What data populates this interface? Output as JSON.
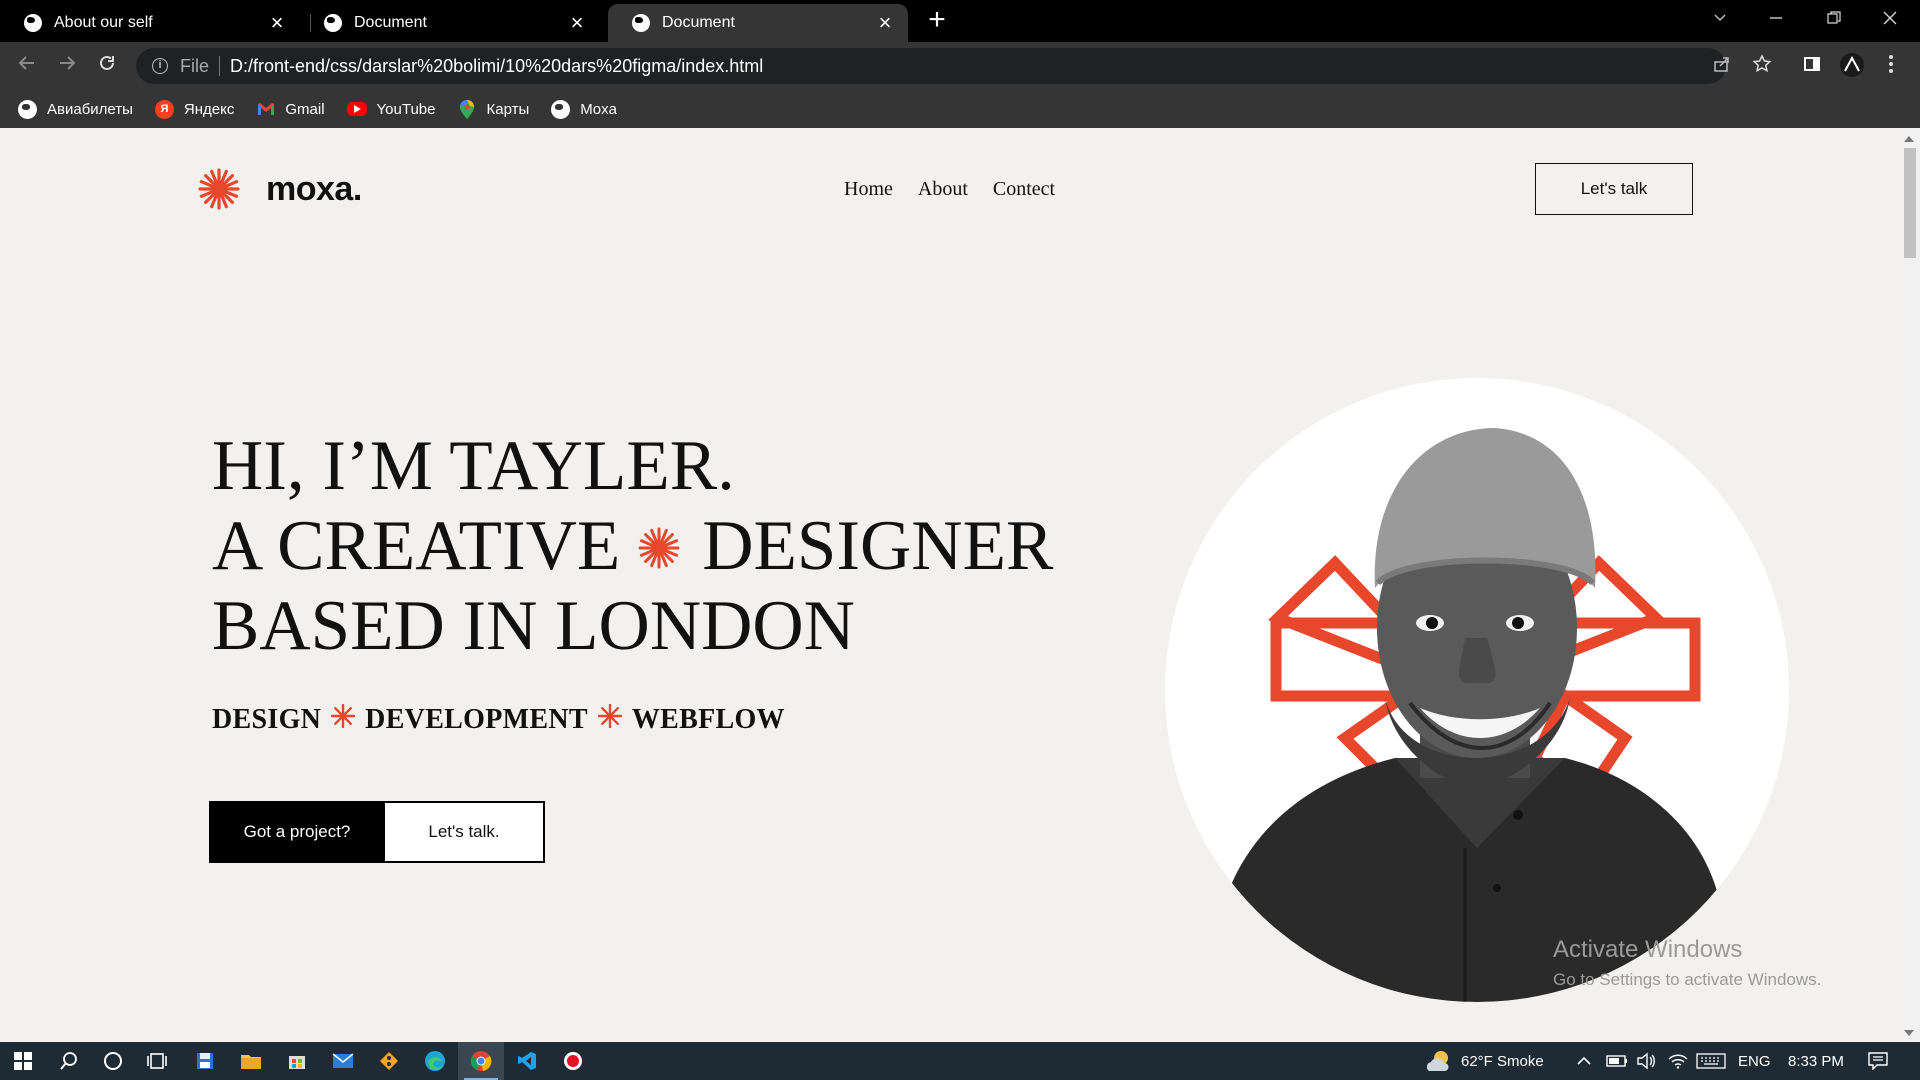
{
  "browser": {
    "tabs": [
      {
        "title": "About our self",
        "active": false
      },
      {
        "title": "Document",
        "active": false
      },
      {
        "title": "Document",
        "active": true
      }
    ],
    "address": {
      "scheme": "File",
      "url": "D:/front-end/css/darslar%20bolimi/10%20dars%20figma/index.html"
    },
    "bookmarks": [
      {
        "label": "Авиабилеты",
        "icon": "globe-icon"
      },
      {
        "label": "Яндекс",
        "icon": "yandex-icon"
      },
      {
        "label": "Gmail",
        "icon": "gmail-icon"
      },
      {
        "label": "YouTube",
        "icon": "youtube-icon"
      },
      {
        "label": "Карты",
        "icon": "maps-pin-icon"
      },
      {
        "label": "Moxa",
        "icon": "globe-icon"
      }
    ]
  },
  "site": {
    "logo_text": "moxa.",
    "nav": [
      "Home",
      "About",
      "Contect"
    ],
    "talk_button": "Let's talk",
    "hero": {
      "line1": "HI, I’M TAYLER.",
      "line2_a": "A CREATIVE",
      "line2_b": "DESIGNER",
      "line3": "BASED IN LONDON"
    },
    "skills": [
      "DESIGN",
      "DEVELOPMENT",
      "WEBFLOW"
    ],
    "cta_primary": "Got a project?",
    "cta_secondary": "Let's talk."
  },
  "watermark": {
    "title": "Activate Windows",
    "subtitle": "Go to Settings to activate Windows."
  },
  "taskbar": {
    "weather": "62°F  Smoke",
    "language": "ENG",
    "time": "8:33 PM"
  },
  "colors": {
    "accent": "#e8472b",
    "page_bg": "#f2f1ef",
    "chrome_dark": "#353535",
    "taskbar": "#1e2b35"
  }
}
